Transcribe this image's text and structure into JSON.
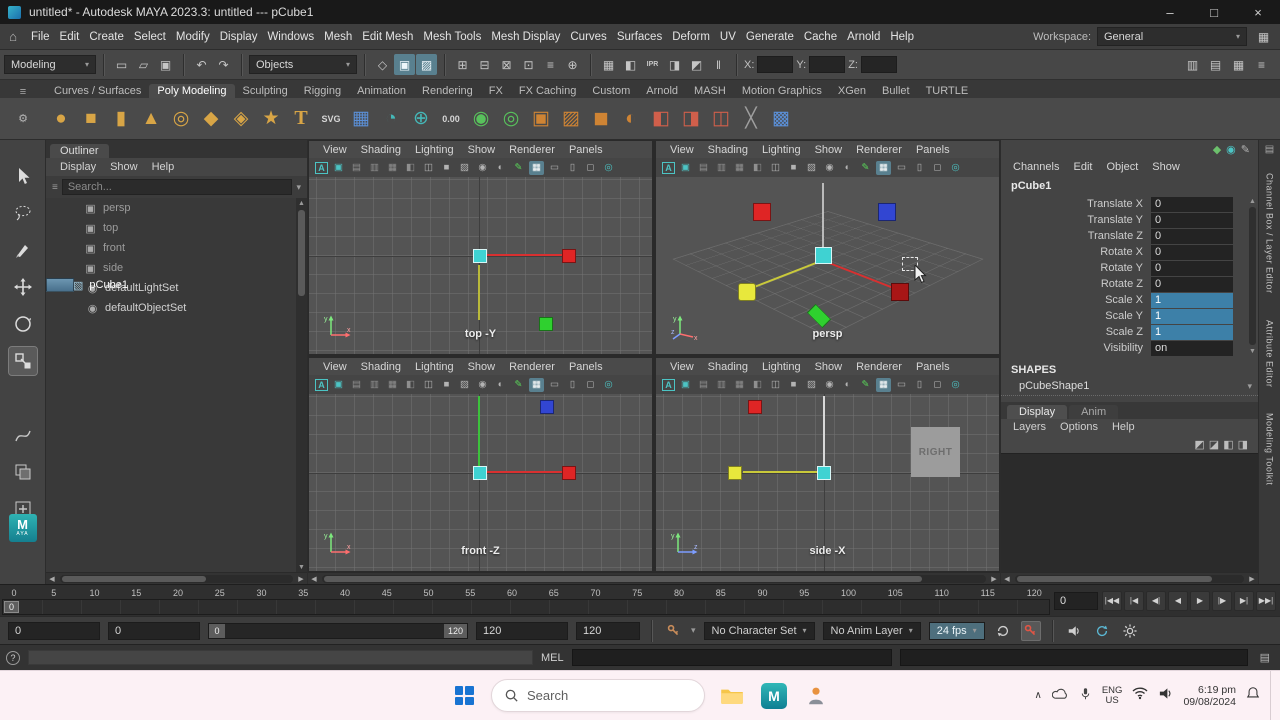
{
  "window": {
    "title": "untitled* - Autodesk MAYA 2023.3: untitled --- pCube1",
    "minimize": "–",
    "maximize": "□",
    "close": "×"
  },
  "menu_bar": {
    "items": [
      "File",
      "Edit",
      "Create",
      "Select",
      "Modify",
      "Display",
      "Windows",
      "Mesh",
      "Edit Mesh",
      "Mesh Tools",
      "Mesh Display",
      "Curves",
      "Surfaces",
      "Deform",
      "UV",
      "Generate",
      "Cache",
      "Arnold",
      "Help"
    ],
    "workspace_label": "Workspace:",
    "workspace_value": "General"
  },
  "status_line": {
    "mode": "Modeling",
    "selection_mask": "Objects",
    "file_icons": [
      {
        "name": "new-scene-icon",
        "glyph": "▭"
      },
      {
        "name": "open-scene-icon",
        "glyph": "▱"
      },
      {
        "name": "save-scene-icon",
        "glyph": "▣"
      }
    ],
    "history_icons": [
      {
        "name": "undo-icon",
        "glyph": "↶"
      },
      {
        "name": "redo-icon",
        "glyph": "↷"
      }
    ],
    "mask_icons": [
      {
        "name": "select-hierarchy-icon",
        "glyph": "◇"
      },
      {
        "name": "select-object-icon",
        "glyph": "▣",
        "cls": "on"
      },
      {
        "name": "select-component-icon",
        "glyph": "▨",
        "cls": "on"
      }
    ],
    "snap_icons": [
      {
        "name": "snap-grid-icon",
        "glyph": "⊞"
      },
      {
        "name": "snap-curve-icon",
        "glyph": "⊟"
      },
      {
        "name": "snap-point-icon",
        "glyph": "⊠"
      },
      {
        "name": "snap-projected-center-icon",
        "glyph": "⊡"
      },
      {
        "name": "snap-view-plane-icon",
        "glyph": "≡"
      },
      {
        "name": "make-live-icon",
        "glyph": "⊕"
      }
    ],
    "render_icons": [
      {
        "name": "render-view-icon",
        "glyph": "▦"
      },
      {
        "name": "render-current-frame-icon",
        "glyph": "◧"
      },
      {
        "name": "ipr-render-icon",
        "glyph": "IPR",
        "cls": "txt"
      },
      {
        "name": "render-settings-icon",
        "glyph": "◨"
      },
      {
        "name": "hypershade-icon",
        "glyph": "◩"
      },
      {
        "name": "pause-viewport-icon",
        "glyph": "‖"
      }
    ],
    "coord_labels": {
      "x": "X:",
      "y": "Y:",
      "z": "Z:"
    },
    "sidebar_icons": [
      {
        "name": "toggle-attribute-editor-icon",
        "glyph": "▥"
      },
      {
        "name": "toggle-tool-settings-icon",
        "glyph": "▤"
      },
      {
        "name": "toggle-channel-box-icon",
        "glyph": "▦"
      },
      {
        "name": "toggle-modeling-toolkit-icon",
        "glyph": "≡"
      }
    ]
  },
  "shelf": {
    "tabs": [
      {
        "label": "Curves / Surfaces"
      },
      {
        "label": "Poly Modeling",
        "active": true
      },
      {
        "label": "Sculpting"
      },
      {
        "label": "Rigging"
      },
      {
        "label": "Animation"
      },
      {
        "label": "Rendering"
      },
      {
        "label": "FX"
      },
      {
        "label": "FX Caching"
      },
      {
        "label": "Custom"
      },
      {
        "label": "Arnold"
      },
      {
        "label": "MASH"
      },
      {
        "label": "Motion Graphics"
      },
      {
        "label": "XGen"
      },
      {
        "label": "Bullet"
      },
      {
        "label": "TURTLE"
      }
    ],
    "icons": [
      {
        "name": "poly-sphere-icon",
        "glyph": "●",
        "cls": "gold"
      },
      {
        "name": "poly-cube-icon",
        "glyph": "■",
        "cls": "gold"
      },
      {
        "name": "poly-cylinder-icon",
        "glyph": "▮",
        "cls": "gold"
      },
      {
        "name": "poly-cone-icon",
        "glyph": "▲",
        "cls": "gold"
      },
      {
        "name": "poly-torus-icon",
        "glyph": "◎",
        "cls": "gold"
      },
      {
        "name": "poly-plane-icon",
        "glyph": "◆",
        "cls": "gold"
      },
      {
        "name": "platonic-solid-icon",
        "glyph": "◈",
        "cls": "gold"
      },
      {
        "name": "sweep-mesh-icon",
        "glyph": "★",
        "cls": "gold"
      },
      {
        "name": "create-type-icon",
        "glyph": "T",
        "cls": "type"
      },
      {
        "name": "svg-tool-icon",
        "glyph": "SVG",
        "cls": "text"
      },
      {
        "name": "remesh-grid-icon",
        "glyph": "▦",
        "cls": "blue"
      },
      {
        "name": "camera-orbit-icon",
        "glyph": "◔",
        "cls": "teal"
      },
      {
        "name": "align-objects-icon",
        "glyph": "⊕",
        "cls": "teal"
      },
      {
        "name": "measure-distance-icon",
        "glyph": "0.00",
        "cls": "text"
      },
      {
        "name": "boolean-union-icon",
        "glyph": "◉",
        "cls": "green"
      },
      {
        "name": "boolean-difference-icon",
        "glyph": "◎",
        "cls": "green"
      },
      {
        "name": "combine-icon",
        "glyph": "▣",
        "cls": "orange"
      },
      {
        "name": "separate-icon",
        "glyph": "▨",
        "cls": "orange"
      },
      {
        "name": "smooth-icon",
        "glyph": "◼",
        "cls": "orange"
      },
      {
        "name": "mirror-icon",
        "glyph": "◐",
        "cls": "orange"
      },
      {
        "name": "extrude-icon",
        "glyph": "◧",
        "cls": "red"
      },
      {
        "name": "bevel-icon",
        "glyph": "◨",
        "cls": "red"
      },
      {
        "name": "bridge-icon",
        "glyph": "◫",
        "cls": "red"
      },
      {
        "name": "multi-cut-icon",
        "glyph": "╳",
        "cls": "dim"
      },
      {
        "name": "quad-draw-icon",
        "glyph": "▩",
        "cls": "blue"
      }
    ]
  },
  "outliner": {
    "title": "Outliner",
    "menus": [
      "Display",
      "Show",
      "Help"
    ],
    "search_placeholder": "Search...",
    "items": [
      {
        "label": "persp",
        "cls": "camera"
      },
      {
        "label": "top",
        "cls": "camera"
      },
      {
        "label": "front",
        "cls": "camera"
      },
      {
        "label": "side",
        "cls": "camera"
      },
      {
        "label": "pCube1",
        "cls": "cube",
        "selected": true
      },
      {
        "label": "defaultLightSet",
        "cls": "set"
      },
      {
        "label": "defaultObjectSet",
        "cls": "set"
      }
    ]
  },
  "viewport_menus": [
    "View",
    "Shading",
    "Lighting",
    "Show",
    "Renderer",
    "Panels"
  ],
  "viewport_icons": [
    {
      "name": "select-camera-icon",
      "glyph": "A",
      "cls": "teal-outline"
    },
    {
      "name": "lock-camera-icon",
      "glyph": "▣",
      "cls": "teal"
    },
    {
      "name": "camera-attributes-icon",
      "glyph": "▤",
      "cls": "dim"
    },
    {
      "name": "bookmarks-icon",
      "glyph": "▥",
      "cls": "dim"
    },
    {
      "name": "image-plane-icon",
      "glyph": "▦",
      "cls": "dim"
    },
    {
      "name": "two-d-pan-zoom-icon",
      "glyph": "◧",
      "cls": "dim"
    },
    {
      "name": "wireframe-icon",
      "glyph": "◫"
    },
    {
      "name": "smooth-shade-icon",
      "glyph": "■"
    },
    {
      "name": "textured-icon",
      "glyph": "▨"
    },
    {
      "name": "use-all-lights-icon",
      "glyph": "◉"
    },
    {
      "name": "shadows-icon",
      "glyph": "◐"
    },
    {
      "name": "grease-pencil-icon",
      "glyph": "✎",
      "cls": "green"
    },
    {
      "name": "grid-toggle-icon",
      "glyph": "▦",
      "cls": "active"
    },
    {
      "name": "film-gate-icon",
      "glyph": "▭"
    },
    {
      "name": "resolution-gate-icon",
      "glyph": "▯"
    },
    {
      "name": "gate-mask-icon",
      "glyph": "◻"
    },
    {
      "name": "isolate-select-icon",
      "glyph": "◎",
      "cls": "teal"
    }
  ],
  "viewports": {
    "top": {
      "label": "top -Y"
    },
    "persp": {
      "label": "persp"
    },
    "front": {
      "label": "front -Z"
    },
    "side": {
      "label": "side -X",
      "image_plane_label": "RIGHT"
    }
  },
  "channel_box": {
    "header_icons": [
      {
        "name": "channel-speed-icon",
        "glyph": "◆",
        "cls": "green"
      },
      {
        "name": "channel-sync-icon",
        "glyph": "◉",
        "cls": "teal"
      },
      {
        "name": "edit-channels-icon",
        "glyph": "✎",
        "cls": "gray"
      }
    ],
    "menus": [
      "Channels",
      "Edit",
      "Object",
      "Show"
    ],
    "node_name": "pCube1",
    "attributes": [
      {
        "label": "Translate X",
        "value": "0"
      },
      {
        "label": "Translate Y",
        "value": "0"
      },
      {
        "label": "Translate Z",
        "value": "0"
      },
      {
        "label": "Rotate X",
        "value": "0"
      },
      {
        "label": "Rotate Y",
        "value": "0"
      },
      {
        "label": "Rotate Z",
        "value": "0"
      },
      {
        "label": "Scale X",
        "value": "1",
        "highlight": true
      },
      {
        "label": "Scale Y",
        "value": "1",
        "highlight": true
      },
      {
        "label": "Scale Z",
        "value": "1",
        "highlight": true
      },
      {
        "label": "Visibility",
        "value": "on"
      }
    ],
    "shapes_header": "SHAPES",
    "shape_name": "pCubeShape1",
    "layer_tabs": [
      {
        "label": "Display",
        "active": true
      },
      {
        "label": "Anim"
      }
    ],
    "layer_menus": [
      "Layers",
      "Options",
      "Help"
    ],
    "layer_icons": [
      {
        "name": "layer-move-up-icon",
        "glyph": "◩"
      },
      {
        "name": "layer-move-down-icon",
        "glyph": "◪"
      },
      {
        "name": "new-empty-layer-icon",
        "glyph": "◧"
      },
      {
        "name": "new-layer-from-selected-icon",
        "glyph": "◨"
      }
    ]
  },
  "right_tabs": [
    "Channel Box / Layer Editor",
    "Attribute Editor",
    "Modeling Toolkit"
  ],
  "timeline": {
    "ticks": [
      "0",
      "5",
      "10",
      "15",
      "20",
      "25",
      "30",
      "35",
      "40",
      "45",
      "50",
      "55",
      "60",
      "65",
      "70",
      "75",
      "80",
      "85",
      "90",
      "95",
      "100",
      "105",
      "110",
      "115",
      "120"
    ],
    "current_frame": "0",
    "current_frame_field": "0"
  },
  "playback_controls": [
    {
      "name": "go-to-start-button",
      "glyph": "|◀◀"
    },
    {
      "name": "step-back-frame-button",
      "glyph": "|◀"
    },
    {
      "name": "step-back-key-button",
      "glyph": "◀|"
    },
    {
      "name": "play-backward-button",
      "glyph": "◀"
    },
    {
      "name": "play-forward-button",
      "glyph": "▶"
    },
    {
      "name": "step-forward-key-button",
      "glyph": "|▶"
    },
    {
      "name": "step-forward-frame-button",
      "glyph": "▶|"
    },
    {
      "name": "go-to-end-button",
      "glyph": "▶▶|"
    }
  ],
  "range_slider": {
    "anim_start": "0",
    "playback_start": "0",
    "range_start": "0",
    "range_end": "120",
    "playback_end": "120",
    "anim_end": "120",
    "character_set": "No Character Set",
    "anim_layer": "No Anim Layer",
    "fps": "24 fps"
  },
  "command_line": {
    "help_glyph": "?",
    "label": "MEL"
  },
  "taskbar": {
    "search_placeholder": "Search",
    "language": "ENG",
    "region": "US",
    "time": "6:19 pm",
    "date": "09/08/2024"
  },
  "colors": {
    "selection_highlight": "#4f7da2",
    "channel_highlight": "#3d80a8",
    "cube_red": "#df2525",
    "cube_dark_red": "#a81616",
    "cube_blue": "#3246d2",
    "cube_cyan": "#3fd2d2",
    "cube_yellow": "#e8e83c",
    "cube_green": "#2fd02f",
    "maya_teal": "#1f9f9f",
    "taskbar_bg": "#fcf1f5"
  }
}
